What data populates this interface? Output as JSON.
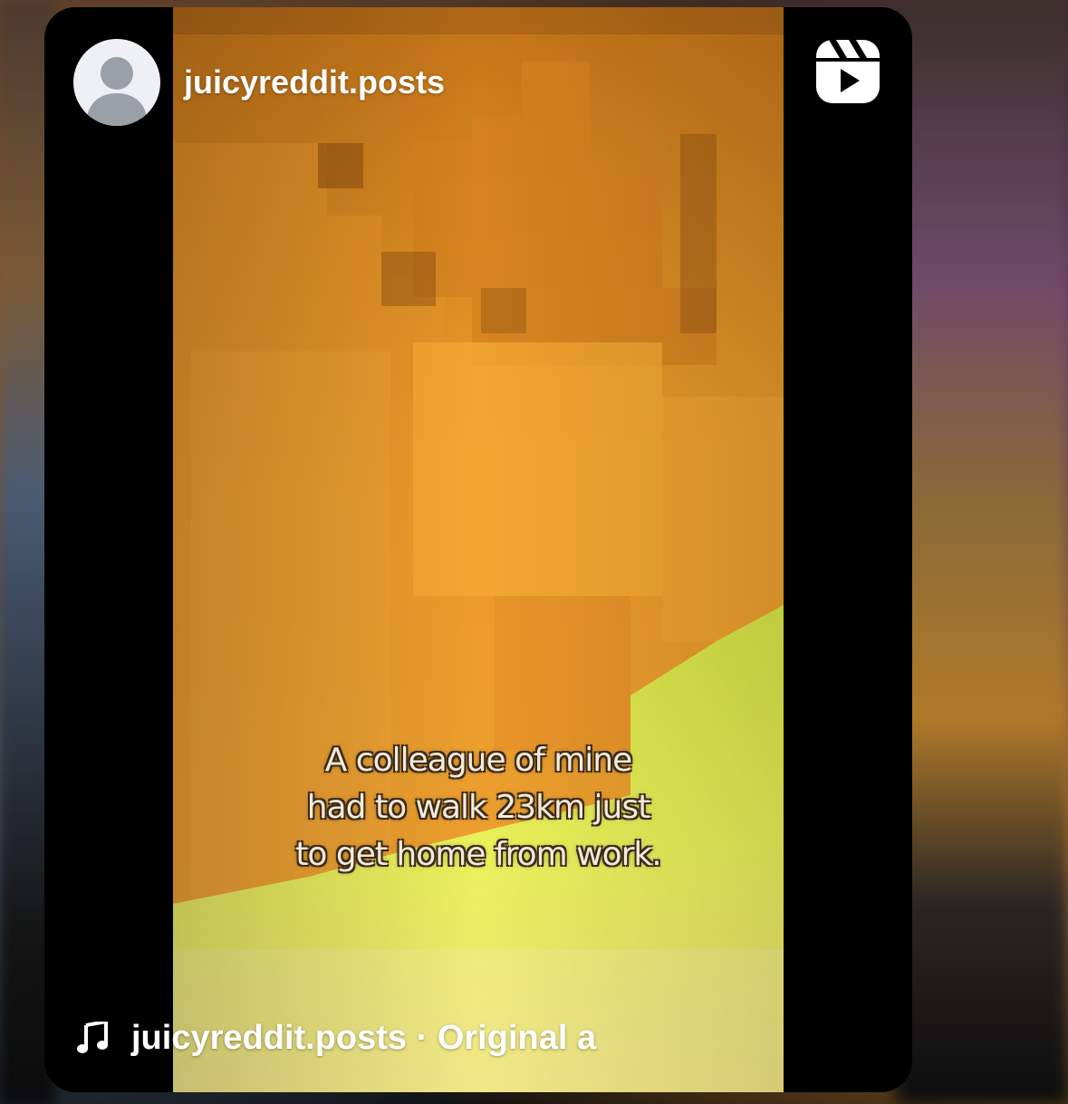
{
  "post": {
    "username": "juicyreddit.posts",
    "avatar_icon": "default-profile-avatar-icon",
    "reels_icon": "reels-icon"
  },
  "video": {
    "caption_lines": [
      "A colleague of mine",
      "had to walk 23km just",
      "to get home from work."
    ]
  },
  "audio": {
    "icon": "music-note-icon",
    "label": "juicyreddit.posts · Original a"
  },
  "colors": {
    "card_background": "#000000",
    "text": "#ffffff",
    "avatar_background": "#eef0f3",
    "avatar_silhouette": "#9aa0a8"
  }
}
